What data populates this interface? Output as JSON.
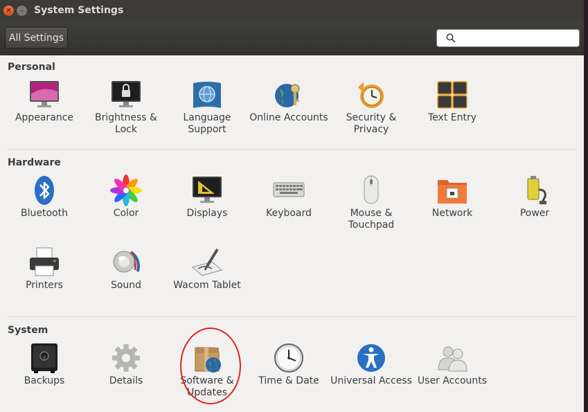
{
  "window": {
    "title": "System Settings"
  },
  "toolbar": {
    "all_settings": "All Settings",
    "search_placeholder": "",
    "search_value": ""
  },
  "sections": {
    "personal": {
      "title": "Personal",
      "items": [
        {
          "label": "Appearance",
          "icon": "appearance-icon"
        },
        {
          "label": "Brightness & Lock",
          "icon": "brightness-lock-icon"
        },
        {
          "label": "Language Support",
          "icon": "language-support-icon"
        },
        {
          "label": "Online Accounts",
          "icon": "online-accounts-icon"
        },
        {
          "label": "Security & Privacy",
          "icon": "security-privacy-icon"
        },
        {
          "label": "Text Entry",
          "icon": "text-entry-icon"
        }
      ]
    },
    "hardware": {
      "title": "Hardware",
      "items": [
        {
          "label": "Bluetooth",
          "icon": "bluetooth-icon"
        },
        {
          "label": "Color",
          "icon": "color-icon"
        },
        {
          "label": "Displays",
          "icon": "displays-icon"
        },
        {
          "label": "Keyboard",
          "icon": "keyboard-icon"
        },
        {
          "label": "Mouse & Touchpad",
          "icon": "mouse-touchpad-icon"
        },
        {
          "label": "Network",
          "icon": "network-icon"
        },
        {
          "label": "Power",
          "icon": "power-icon"
        },
        {
          "label": "Printers",
          "icon": "printer-icon"
        },
        {
          "label": "Sound",
          "icon": "sound-icon"
        },
        {
          "label": "Wacom Tablet",
          "icon": "wacom-tablet-icon"
        }
      ]
    },
    "system": {
      "title": "System",
      "items": [
        {
          "label": "Backups",
          "icon": "backups-icon"
        },
        {
          "label": "Details",
          "icon": "details-icon"
        },
        {
          "label": "Software & Updates",
          "icon": "software-updates-icon"
        },
        {
          "label": "Time & Date",
          "icon": "time-date-icon"
        },
        {
          "label": "Universal Access",
          "icon": "universal-access-icon"
        },
        {
          "label": "User Accounts",
          "icon": "user-accounts-icon"
        }
      ]
    }
  },
  "colors": {
    "titlebar": "#3c3b37",
    "background": "#f2f1f0",
    "highlight": "#e0231c"
  }
}
